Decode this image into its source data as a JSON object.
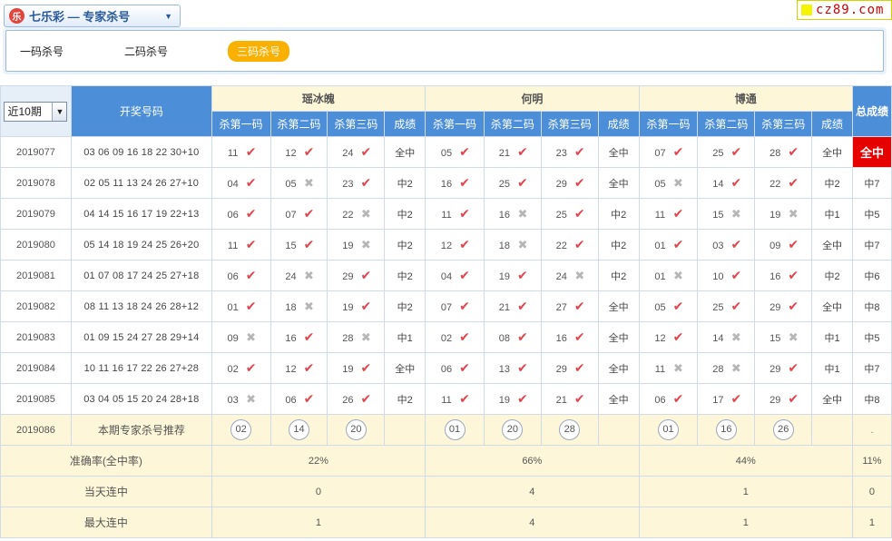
{
  "header": {
    "logo_glyph": "乐",
    "title": "七乐彩 — 专家杀号",
    "brand": "cz89.com"
  },
  "tabs": [
    {
      "label": "一码杀号",
      "active": false
    },
    {
      "label": "二码杀号",
      "active": false
    },
    {
      "label": "三码杀号",
      "active": true
    }
  ],
  "table": {
    "period_select": "近10期",
    "col_draw": "开奖号码",
    "col_total": "总成绩",
    "experts": [
      "瑶冰魄",
      "何明",
      "博通"
    ],
    "sub_headers": [
      "杀第一码",
      "杀第二码",
      "杀第三码",
      "成绩"
    ],
    "rows": [
      {
        "period": "2019077",
        "draw": "03 06 09 16 18 22 30+10",
        "experts": [
          {
            "k": [
              [
                "11",
                1
              ],
              [
                "12",
                1
              ],
              [
                "24",
                1
              ]
            ],
            "r": "全中"
          },
          {
            "k": [
              [
                "05",
                1
              ],
              [
                "21",
                1
              ],
              [
                "23",
                1
              ]
            ],
            "r": "全中"
          },
          {
            "k": [
              [
                "07",
                1
              ],
              [
                "25",
                1
              ],
              [
                "28",
                1
              ]
            ],
            "r": "全中"
          }
        ],
        "total": "全中",
        "best": true
      },
      {
        "period": "2019078",
        "draw": "02 05 11 13 24 26 27+10",
        "experts": [
          {
            "k": [
              [
                "04",
                1
              ],
              [
                "05",
                0
              ],
              [
                "23",
                1
              ]
            ],
            "r": "中2"
          },
          {
            "k": [
              [
                "16",
                1
              ],
              [
                "25",
                1
              ],
              [
                "29",
                1
              ]
            ],
            "r": "全中"
          },
          {
            "k": [
              [
                "05",
                0
              ],
              [
                "14",
                1
              ],
              [
                "22",
                1
              ]
            ],
            "r": "中2"
          }
        ],
        "total": "中7",
        "best": false
      },
      {
        "period": "2019079",
        "draw": "04 14 15 16 17 19 22+13",
        "experts": [
          {
            "k": [
              [
                "06",
                1
              ],
              [
                "07",
                1
              ],
              [
                "22",
                0
              ]
            ],
            "r": "中2"
          },
          {
            "k": [
              [
                "11",
                1
              ],
              [
                "16",
                0
              ],
              [
                "25",
                1
              ]
            ],
            "r": "中2"
          },
          {
            "k": [
              [
                "11",
                1
              ],
              [
                "15",
                0
              ],
              [
                "19",
                0
              ]
            ],
            "r": "中1"
          }
        ],
        "total": "中5",
        "best": false
      },
      {
        "period": "2019080",
        "draw": "05 14 18 19 24 25 26+20",
        "experts": [
          {
            "k": [
              [
                "11",
                1
              ],
              [
                "15",
                1
              ],
              [
                "19",
                0
              ]
            ],
            "r": "中2"
          },
          {
            "k": [
              [
                "12",
                1
              ],
              [
                "18",
                0
              ],
              [
                "22",
                1
              ]
            ],
            "r": "中2"
          },
          {
            "k": [
              [
                "01",
                1
              ],
              [
                "03",
                1
              ],
              [
                "09",
                1
              ]
            ],
            "r": "全中"
          }
        ],
        "total": "中7",
        "best": false
      },
      {
        "period": "2019081",
        "draw": "01 07 08 17 24 25 27+18",
        "experts": [
          {
            "k": [
              [
                "06",
                1
              ],
              [
                "24",
                0
              ],
              [
                "29",
                1
              ]
            ],
            "r": "中2"
          },
          {
            "k": [
              [
                "04",
                1
              ],
              [
                "19",
                1
              ],
              [
                "24",
                0
              ]
            ],
            "r": "中2"
          },
          {
            "k": [
              [
                "01",
                0
              ],
              [
                "10",
                1
              ],
              [
                "16",
                1
              ]
            ],
            "r": "中2"
          }
        ],
        "total": "中6",
        "best": false
      },
      {
        "period": "2019082",
        "draw": "08 11 13 18 24 26 28+12",
        "experts": [
          {
            "k": [
              [
                "01",
                1
              ],
              [
                "18",
                0
              ],
              [
                "19",
                1
              ]
            ],
            "r": "中2"
          },
          {
            "k": [
              [
                "07",
                1
              ],
              [
                "21",
                1
              ],
              [
                "27",
                1
              ]
            ],
            "r": "全中"
          },
          {
            "k": [
              [
                "05",
                1
              ],
              [
                "25",
                1
              ],
              [
                "29",
                1
              ]
            ],
            "r": "全中"
          }
        ],
        "total": "中8",
        "best": false
      },
      {
        "period": "2019083",
        "draw": "01 09 15 24 27 28 29+14",
        "experts": [
          {
            "k": [
              [
                "09",
                0
              ],
              [
                "16",
                1
              ],
              [
                "28",
                0
              ]
            ],
            "r": "中1"
          },
          {
            "k": [
              [
                "02",
                1
              ],
              [
                "08",
                1
              ],
              [
                "16",
                1
              ]
            ],
            "r": "全中"
          },
          {
            "k": [
              [
                "12",
                1
              ],
              [
                "14",
                0
              ],
              [
                "15",
                0
              ]
            ],
            "r": "中1"
          }
        ],
        "total": "中5",
        "best": false
      },
      {
        "period": "2019084",
        "draw": "10 11 16 17 22 26 27+28",
        "experts": [
          {
            "k": [
              [
                "02",
                1
              ],
              [
                "12",
                1
              ],
              [
                "19",
                1
              ]
            ],
            "r": "全中"
          },
          {
            "k": [
              [
                "06",
                1
              ],
              [
                "13",
                1
              ],
              [
                "29",
                1
              ]
            ],
            "r": "全中"
          },
          {
            "k": [
              [
                "11",
                0
              ],
              [
                "28",
                0
              ],
              [
                "29",
                1
              ]
            ],
            "r": "中1"
          }
        ],
        "total": "中7",
        "best": false
      },
      {
        "period": "2019085",
        "draw": "03 04 05 15 20 24 28+18",
        "experts": [
          {
            "k": [
              [
                "03",
                0
              ],
              [
                "06",
                1
              ],
              [
                "26",
                1
              ]
            ],
            "r": "中2"
          },
          {
            "k": [
              [
                "11",
                1
              ],
              [
                "19",
                1
              ],
              [
                "21",
                1
              ]
            ],
            "r": "全中"
          },
          {
            "k": [
              [
                "06",
                1
              ],
              [
                "17",
                1
              ],
              [
                "29",
                1
              ]
            ],
            "r": "全中"
          }
        ],
        "total": "中8",
        "best": false
      }
    ],
    "next": {
      "period": "2019086",
      "label": "本期专家杀号推荐",
      "picks": [
        [
          "02",
          "14",
          "20"
        ],
        [
          "01",
          "20",
          "28"
        ],
        [
          "01",
          "16",
          "26"
        ]
      ],
      "total": "."
    },
    "stats": [
      {
        "label": "准确率(全中率)",
        "values": [
          "22%",
          "66%",
          "44%"
        ],
        "total": "11%"
      },
      {
        "label": "当天连中",
        "values": [
          "0",
          "4",
          "1"
        ],
        "total": "0"
      },
      {
        "label": "最大连中",
        "values": [
          "1",
          "4",
          "1"
        ],
        "total": "1"
      }
    ]
  }
}
